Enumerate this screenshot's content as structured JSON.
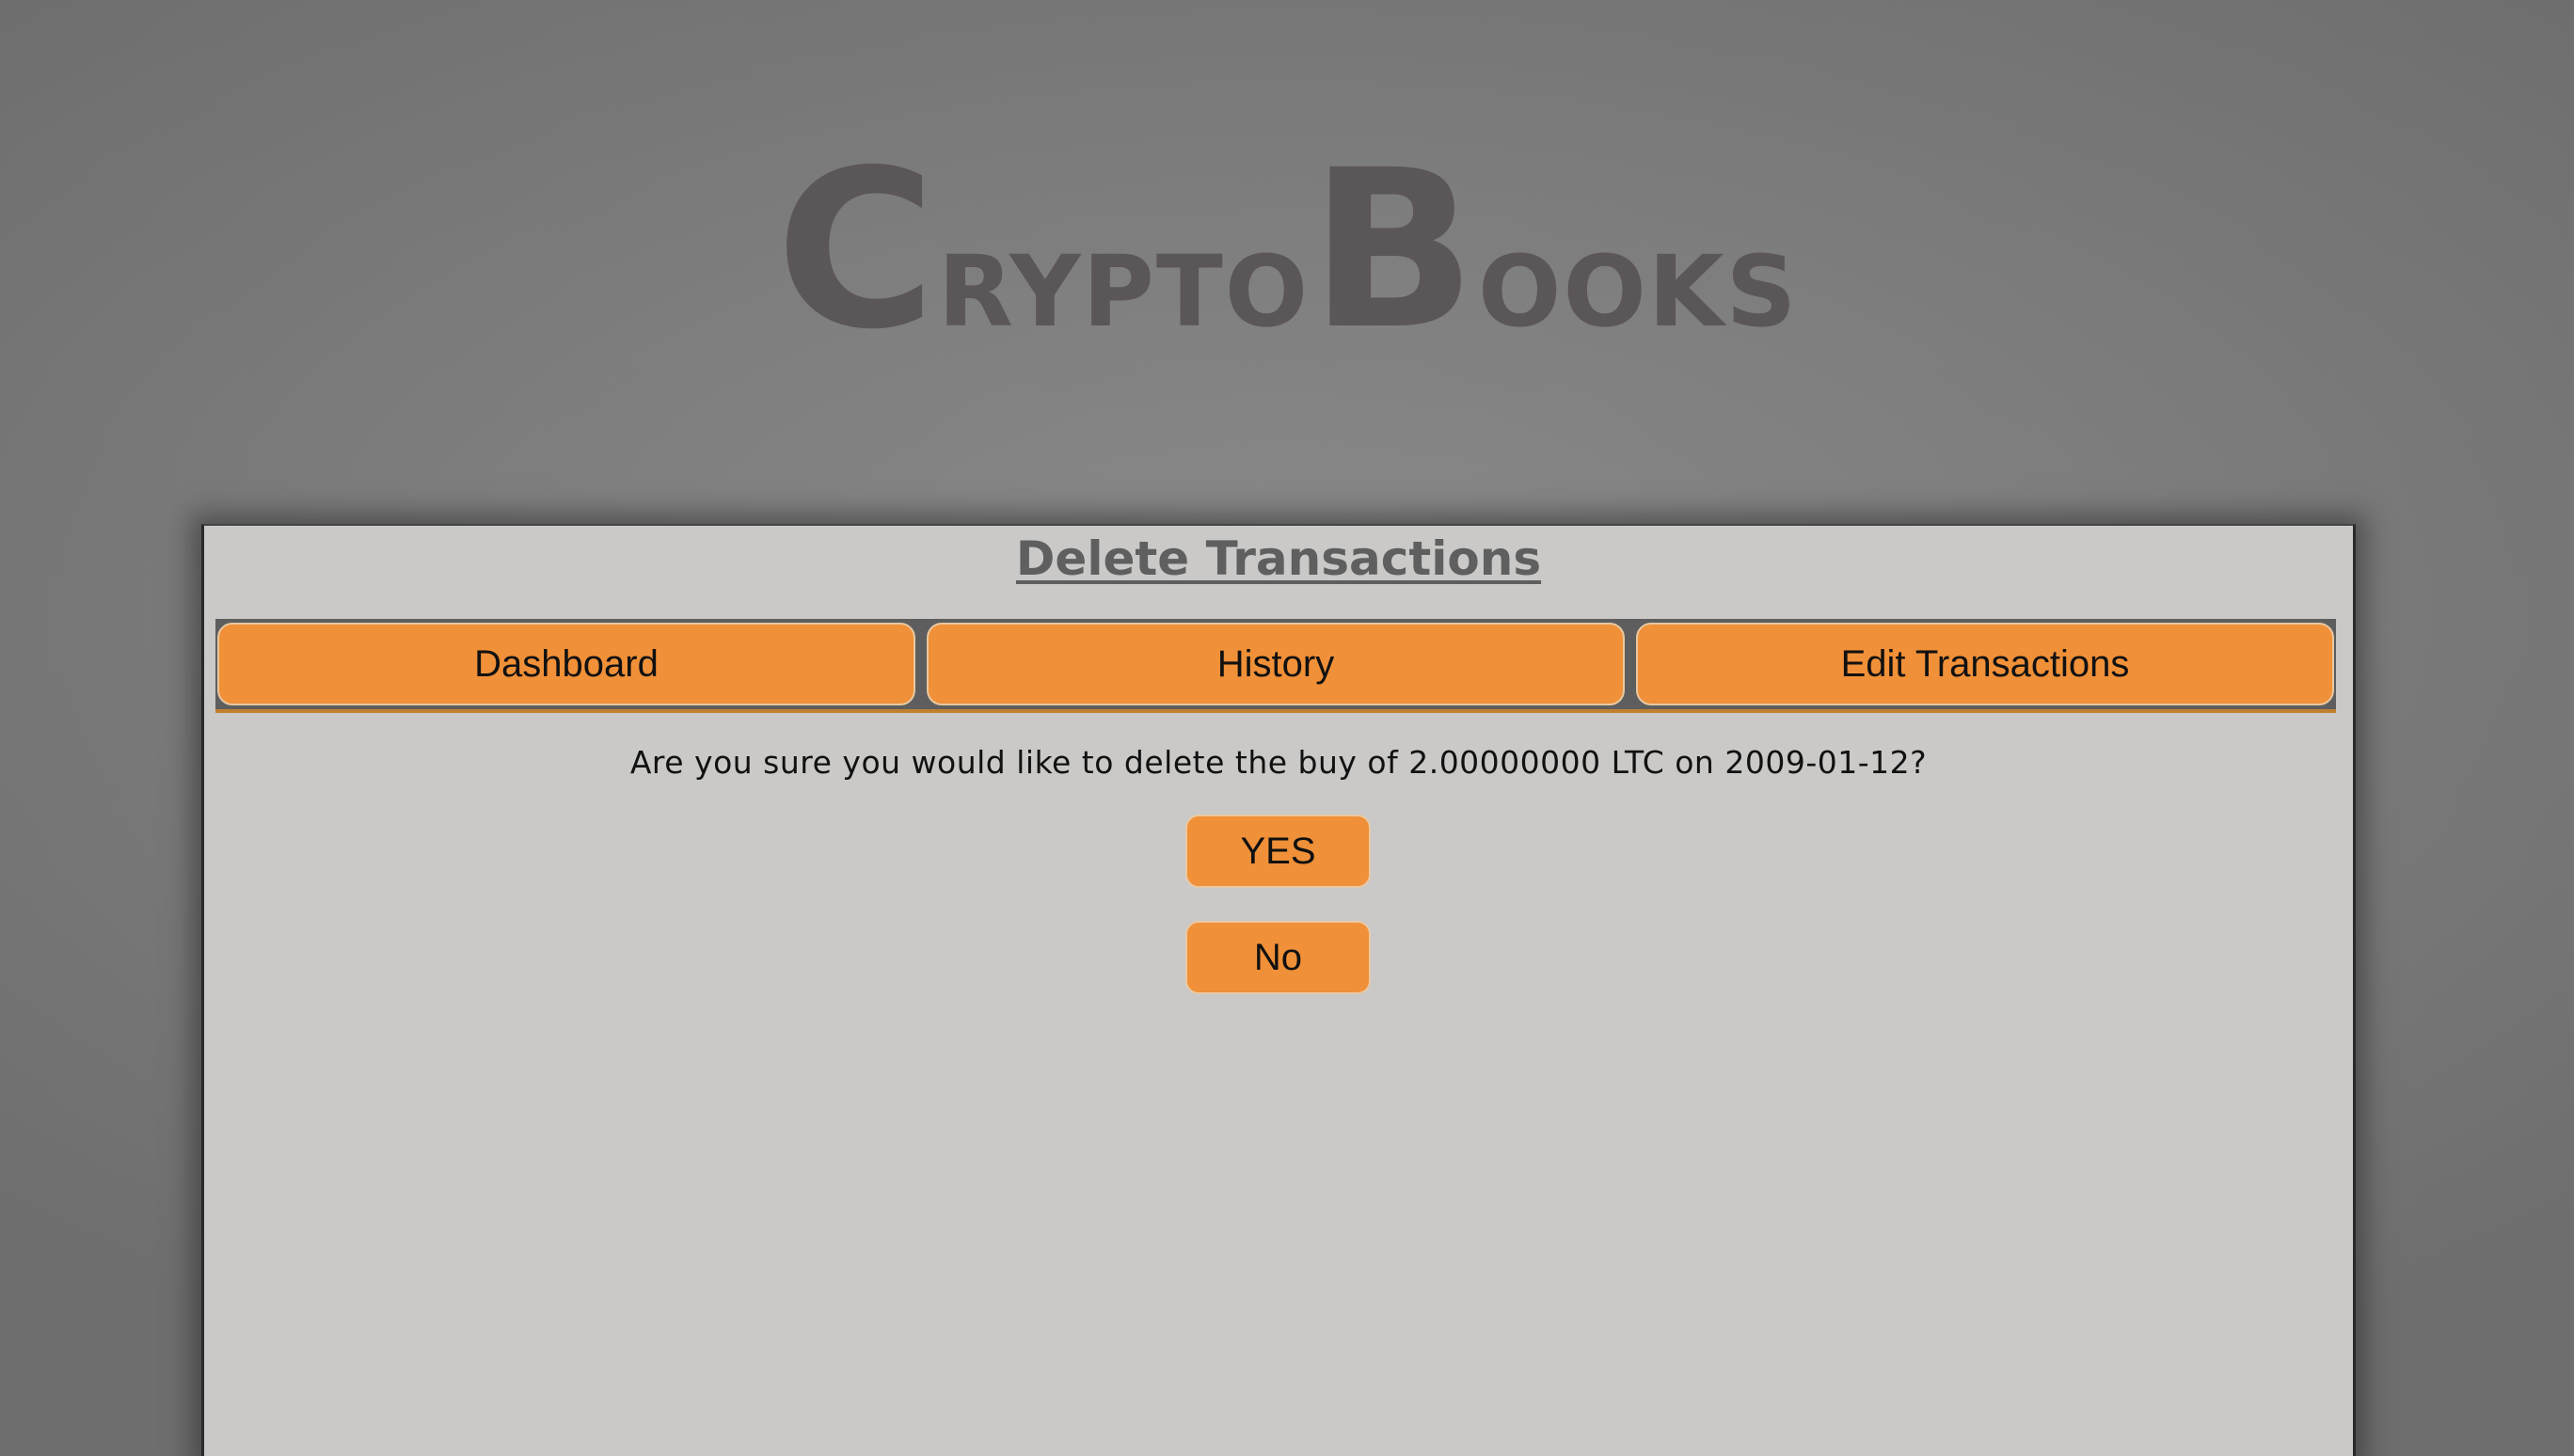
{
  "logo": {
    "cap1": "C",
    "rest1": "rypto",
    "cap2": "B",
    "rest2": "ooks"
  },
  "page": {
    "title": "Delete Transactions"
  },
  "nav": {
    "items": [
      {
        "label": "Dashboard"
      },
      {
        "label": "History"
      },
      {
        "label": "Edit Transactions"
      }
    ]
  },
  "confirm": {
    "question": "Are you sure you would like to delete the buy of 2.00000000 LTC on 2009-01-12?",
    "yes_label": "YES",
    "no_label": "No"
  },
  "colors": {
    "accent": "#f09038",
    "panel_bg": "#cac9c7",
    "logo": "#5b5657"
  }
}
